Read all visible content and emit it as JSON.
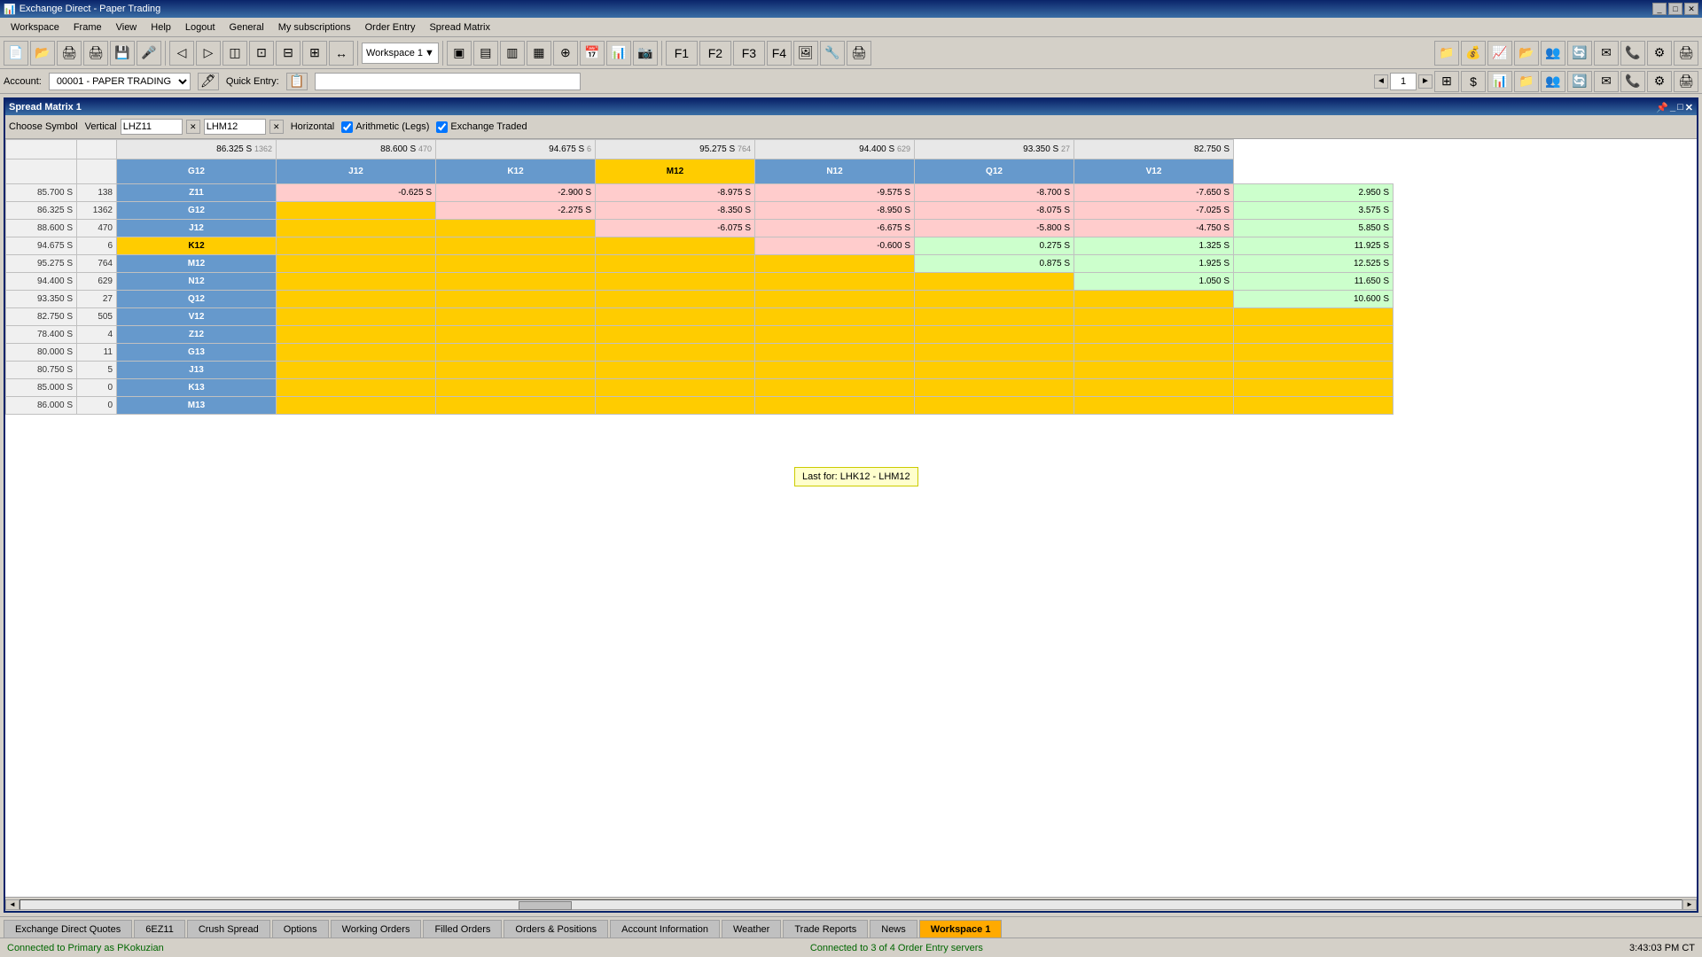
{
  "titleBar": {
    "title": "Exchange Direct - Paper Trading",
    "controls": [
      "_",
      "□",
      "✕"
    ]
  },
  "menuBar": {
    "items": [
      "Workspace",
      "Frame",
      "View",
      "Help",
      "Logout",
      "General",
      "My subscriptions",
      "Order Entry",
      "Spread Matrix"
    ]
  },
  "toolbar": {
    "workspaceLabel": "Workspace 1"
  },
  "accountBar": {
    "accountLabel": "Account:",
    "accountValue": "00001 - PAPER TRADING",
    "quickEntryLabel": "Quick Entry:",
    "pageNum": "1"
  },
  "spreadMatrix": {
    "title": "Spread Matrix 1",
    "symbolLabel": "Choose Symbol",
    "verticalLabel": "Vertical",
    "horizontalLabel": "Horizontal",
    "verticalValue": "LHZ11",
    "horizontalValue": "LHM12",
    "arithmeticLegs": true,
    "exchangeTraded": true,
    "columns": [
      "G12",
      "J12",
      "K12",
      "M12",
      "N12",
      "Q12",
      "V12"
    ],
    "columnPrices": [
      "86.325 S",
      "88.600 S",
      "94.675 S",
      "95.275 S",
      "94.400 S",
      "93.350 S",
      "82.750 S"
    ],
    "columnVols": [
      "1362",
      "470",
      "6",
      "764",
      "629",
      "27",
      ""
    ],
    "rows": [
      {
        "name": "Z11",
        "price": "85.700 S",
        "vol": "138",
        "highlight": false,
        "cells": [
          "-0.625 S",
          "-2.900 S",
          "-8.975 S",
          "-9.575 S",
          "-8.700 S",
          "-7.650 S",
          "2.950 S"
        ]
      },
      {
        "name": "G12",
        "price": "86.325 S",
        "vol": "1362",
        "highlight": false,
        "cells": [
          "",
          "-2.275 S",
          "-8.350 S",
          "-8.950 S",
          "-8.075 S",
          "-7.025 S",
          "3.575 S"
        ]
      },
      {
        "name": "J12",
        "price": "88.600 S",
        "vol": "470",
        "highlight": false,
        "cells": [
          "",
          "",
          "-6.075 S",
          "-6.675 S",
          "-5.800 S",
          "-4.750 S",
          "5.850 S"
        ]
      },
      {
        "name": "K12",
        "price": "94.675 S",
        "vol": "6",
        "highlight": true,
        "cells": [
          "",
          "",
          "",
          "-0.600 S",
          "0.275 S",
          "1.325 S",
          "11.925 S"
        ]
      },
      {
        "name": "M12",
        "price": "95.275 S",
        "vol": "764",
        "highlight": false,
        "cells": [
          "",
          "",
          "",
          "",
          "0.875 S",
          "1.925 S",
          "12.525 S"
        ]
      },
      {
        "name": "N12",
        "price": "94.400 S",
        "vol": "629",
        "highlight": false,
        "cells": [
          "",
          "",
          "",
          "",
          "",
          "1.050 S",
          "11.650 S"
        ]
      },
      {
        "name": "Q12",
        "price": "93.350 S",
        "vol": "27",
        "highlight": false,
        "cells": [
          "",
          "",
          "",
          "",
          "",
          "",
          "10.600 S"
        ]
      },
      {
        "name": "V12",
        "price": "82.750 S",
        "vol": "505",
        "highlight": false,
        "cells": [
          "",
          "",
          "",
          "",
          "",
          "",
          ""
        ]
      },
      {
        "name": "Z12",
        "price": "78.400 S",
        "vol": "4",
        "highlight": false,
        "cells": [
          "",
          "",
          "",
          "",
          "",
          "",
          ""
        ]
      },
      {
        "name": "G13",
        "price": "80.000 S",
        "vol": "11",
        "highlight": false,
        "cells": [
          "",
          "",
          "",
          "",
          "",
          "",
          ""
        ]
      },
      {
        "name": "J13",
        "price": "80.750 S",
        "vol": "5",
        "highlight": false,
        "cells": [
          "",
          "",
          "",
          "",
          "",
          "",
          ""
        ]
      },
      {
        "name": "K13",
        "price": "85.000 S",
        "vol": "0",
        "highlight": false,
        "cells": [
          "",
          "",
          "",
          "",
          "",
          "",
          ""
        ]
      },
      {
        "name": "M13",
        "price": "86.000 S",
        "vol": "0",
        "highlight": false,
        "cells": [
          "",
          "",
          "",
          "",
          "",
          "",
          ""
        ]
      }
    ],
    "tooltip": {
      "visible": true,
      "text": "Last for: LHK12 - LHM12",
      "row": 3,
      "col": 3
    }
  },
  "tabs": [
    {
      "label": "Exchange Direct Quotes",
      "active": false
    },
    {
      "label": "6EZ11",
      "active": false
    },
    {
      "label": "Crush Spread",
      "active": false
    },
    {
      "label": "Options",
      "active": false
    },
    {
      "label": "Working Orders",
      "active": false
    },
    {
      "label": "Filled Orders",
      "active": false
    },
    {
      "label": "Orders & Positions",
      "active": false
    },
    {
      "label": "Account Information",
      "active": false
    },
    {
      "label": "Weather",
      "active": false
    },
    {
      "label": "Trade Reports",
      "active": false
    },
    {
      "label": "News",
      "active": false
    },
    {
      "label": "Workspace 1",
      "active": true
    }
  ],
  "statusBar": {
    "connectionStatus": "Connected to Primary  as PKokuzian",
    "serverStatus": "Connected to 3 of 4 Order Entry servers",
    "time": "3:43:03 PM CT"
  },
  "colors": {
    "headerBlue": "#5588bb",
    "highlight": "#ffcc00",
    "negCell": "#ffcccc",
    "posCell": "#ccffcc",
    "emptyCell": "#ffcc00",
    "activeTab": "#ffaa00"
  }
}
